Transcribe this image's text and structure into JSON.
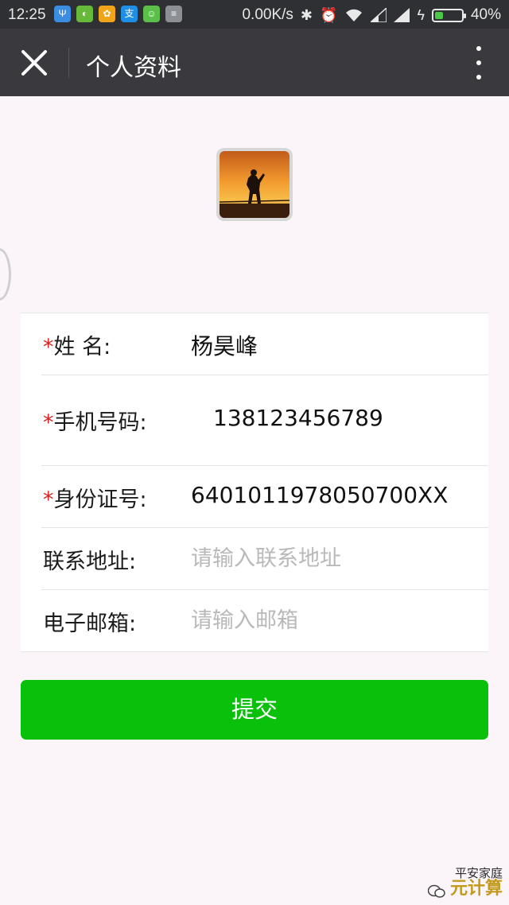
{
  "status_bar": {
    "time": "12:25",
    "network_speed": "0.00K/s",
    "battery_percent": "40%",
    "battery_level": 0.4,
    "icons": [
      "usb-icon",
      "maps-icon",
      "coupon-icon",
      "alipay-icon",
      "android-icon",
      "notes-icon",
      "bluetooth-icon",
      "alarm-icon",
      "wifi-icon",
      "signal-icon",
      "signal-icon",
      "charging-icon"
    ],
    "alipay_glyph": "支"
  },
  "app_bar": {
    "title": "个人资料",
    "close_icon": "close-icon",
    "more_icon": "more-vertical-icon"
  },
  "form": {
    "name": {
      "required_mark": "*",
      "label": "姓 名:",
      "value": "杨昊峰"
    },
    "phone": {
      "required_mark": "*",
      "label": "手机号码:",
      "value": "138123456789"
    },
    "id_number": {
      "required_mark": "*",
      "label": "身份证号:",
      "value": "6401011978050700XX"
    },
    "address": {
      "label": "联系地址:",
      "placeholder": "请输入联系地址"
    },
    "email": {
      "label": "电子邮箱:",
      "placeholder": "请输入邮箱"
    }
  },
  "submit_label": "提交",
  "watermark": {
    "line1": "平安家庭",
    "line2": "元计算"
  },
  "colors": {
    "status_bar_bg": "#2f3033",
    "app_bar_bg": "#3a3a3e",
    "page_bg": "#fbf5fa",
    "required": "#e0201f",
    "submit_bg": "#09c10a",
    "placeholder": "#b9b9b9"
  }
}
